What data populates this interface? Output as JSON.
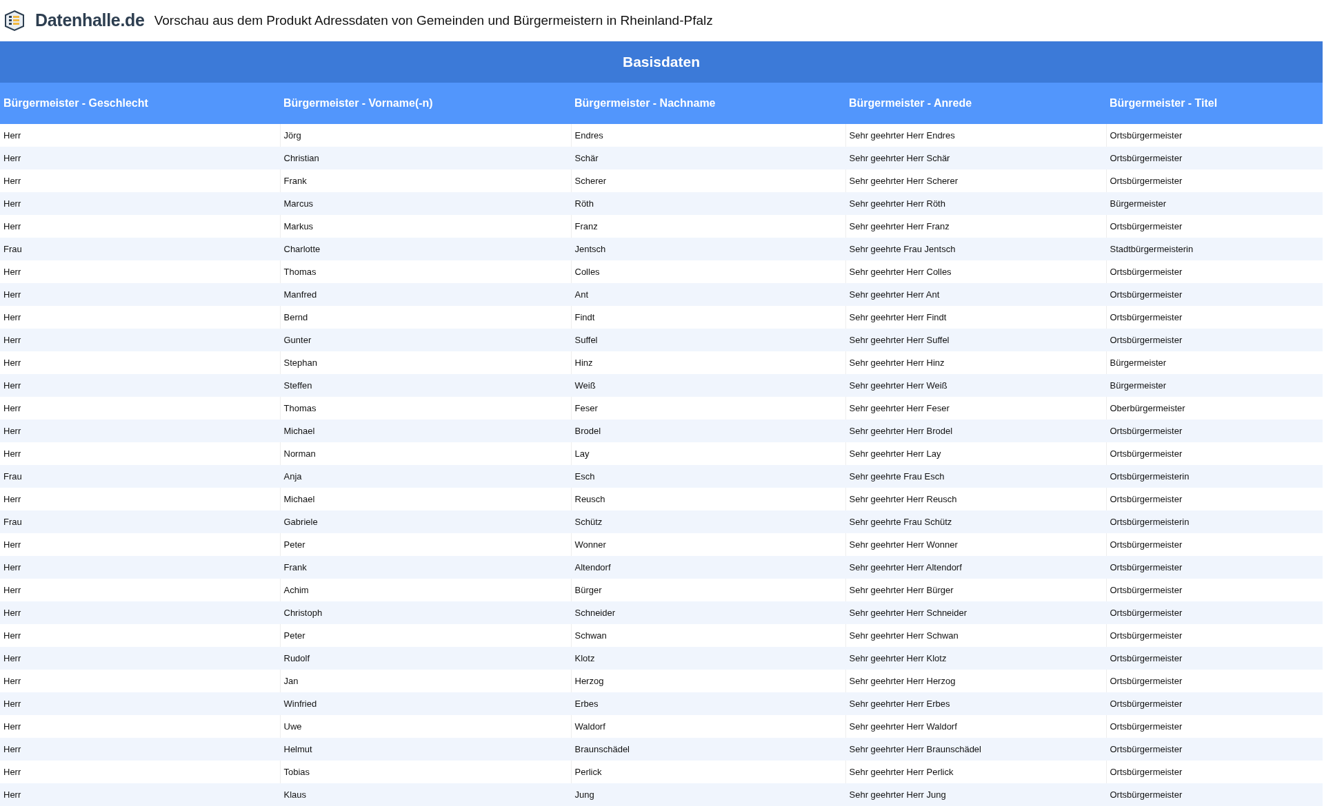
{
  "header": {
    "logo": "Datenhalle.de",
    "title": "Vorschau aus dem Produkt Adressdaten von Gemeinden und Bürgermeistern in Rheinland-Pfalz"
  },
  "table": {
    "group_title": "Basisdaten",
    "columns": [
      "Bürgermeister - Geschlecht",
      "Bürgermeister - Vorname(-n)",
      "Bürgermeister - Nachname",
      "Bürgermeister - Anrede",
      "Bürgermeister - Titel"
    ],
    "rows": [
      [
        "Herr",
        "Jörg",
        "Endres",
        "Sehr geehrter Herr Endres",
        "Ortsbürgermeister"
      ],
      [
        "Herr",
        "Christian",
        "Schär",
        "Sehr geehrter Herr Schär",
        "Ortsbürgermeister"
      ],
      [
        "Herr",
        "Frank",
        "Scherer",
        "Sehr geehrter Herr Scherer",
        "Ortsbürgermeister"
      ],
      [
        "Herr",
        "Marcus",
        "Röth",
        "Sehr geehrter Herr Röth",
        "Bürgermeister"
      ],
      [
        "Herr",
        "Markus",
        "Franz",
        "Sehr geehrter Herr Franz",
        "Ortsbürgermeister"
      ],
      [
        "Frau",
        "Charlotte",
        "Jentsch",
        "Sehr geehrte Frau Jentsch",
        "Stadtbürgermeisterin"
      ],
      [
        "Herr",
        "Thomas",
        "Colles",
        "Sehr geehrter Herr Colles",
        "Ortsbürgermeister"
      ],
      [
        "Herr",
        "Manfred",
        "Ant",
        "Sehr geehrter Herr Ant",
        "Ortsbürgermeister"
      ],
      [
        "Herr",
        "Bernd",
        "Findt",
        "Sehr geehrter Herr Findt",
        "Ortsbürgermeister"
      ],
      [
        "Herr",
        "Gunter",
        "Suffel",
        "Sehr geehrter Herr Suffel",
        "Ortsbürgermeister"
      ],
      [
        "Herr",
        "Stephan",
        "Hinz",
        "Sehr geehrter Herr Hinz",
        "Bürgermeister"
      ],
      [
        "Herr",
        "Steffen",
        "Weiß",
        "Sehr geehrter Herr Weiß",
        "Bürgermeister"
      ],
      [
        "Herr",
        "Thomas",
        "Feser",
        "Sehr geehrter Herr Feser",
        "Oberbürgermeister"
      ],
      [
        "Herr",
        "Michael",
        "Brodel",
        "Sehr geehrter Herr Brodel",
        "Ortsbürgermeister"
      ],
      [
        "Herr",
        "Norman",
        "Lay",
        "Sehr geehrter Herr Lay",
        "Ortsbürgermeister"
      ],
      [
        "Frau",
        "Anja",
        "Esch",
        "Sehr geehrte Frau Esch",
        "Ortsbürgermeisterin"
      ],
      [
        "Herr",
        "Michael",
        "Reusch",
        "Sehr geehrter Herr Reusch",
        "Ortsbürgermeister"
      ],
      [
        "Frau",
        "Gabriele",
        "Schütz",
        "Sehr geehrte Frau Schütz",
        "Ortsbürgermeisterin"
      ],
      [
        "Herr",
        "Peter",
        "Wonner",
        "Sehr geehrter Herr Wonner",
        "Ortsbürgermeister"
      ],
      [
        "Herr",
        "Frank",
        "Altendorf",
        "Sehr geehrter Herr Altendorf",
        "Ortsbürgermeister"
      ],
      [
        "Herr",
        "Achim",
        "Bürger",
        "Sehr geehrter Herr Bürger",
        "Ortsbürgermeister"
      ],
      [
        "Herr",
        "Christoph",
        "Schneider",
        "Sehr geehrter Herr Schneider",
        "Ortsbürgermeister"
      ],
      [
        "Herr",
        "Peter",
        "Schwan",
        "Sehr geehrter Herr Schwan",
        "Ortsbürgermeister"
      ],
      [
        "Herr",
        "Rudolf",
        "Klotz",
        "Sehr geehrter Herr Klotz",
        "Ortsbürgermeister"
      ],
      [
        "Herr",
        "Jan",
        "Herzog",
        "Sehr geehrter Herr Herzog",
        "Ortsbürgermeister"
      ],
      [
        "Herr",
        "Winfried",
        "Erbes",
        "Sehr geehrter Herr Erbes",
        "Ortsbürgermeister"
      ],
      [
        "Herr",
        "Uwe",
        "Waldorf",
        "Sehr geehrter Herr Waldorf",
        "Ortsbürgermeister"
      ],
      [
        "Herr",
        "Helmut",
        "Braunschädel",
        "Sehr geehrter Herr Braunschädel",
        "Ortsbürgermeister"
      ],
      [
        "Herr",
        "Tobias",
        "Perlick",
        "Sehr geehrter Herr Perlick",
        "Ortsbürgermeister"
      ],
      [
        "Herr",
        "Klaus",
        "Jung",
        "Sehr geehrter Herr Jung",
        "Ortsbürgermeister"
      ]
    ]
  }
}
